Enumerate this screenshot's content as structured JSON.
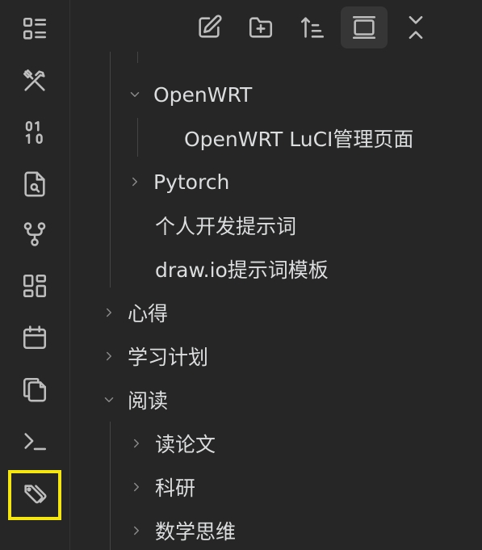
{
  "ribbon": {
    "items": [
      {
        "icon": "list-icon"
      },
      {
        "icon": "tools-icon"
      },
      {
        "icon": "binary-icon"
      },
      {
        "icon": "file-search-icon"
      },
      {
        "icon": "git-fork-icon"
      },
      {
        "icon": "layout-grid-icon"
      },
      {
        "icon": "calendar-icon"
      },
      {
        "icon": "copy-icon"
      },
      {
        "icon": "terminal-icon"
      },
      {
        "icon": "tags-icon",
        "highlighted": true
      }
    ],
    "highlight_color": "#f5e60f"
  },
  "toolbar": {
    "buttons": [
      {
        "icon": "new-note-icon"
      },
      {
        "icon": "new-folder-icon"
      },
      {
        "icon": "sort-icon"
      },
      {
        "icon": "collapse-all-icon",
        "active": true
      },
      {
        "icon": "close-icon"
      }
    ]
  },
  "tree": {
    "items": [
      {
        "label": "OpenWRT",
        "expanded": true
      },
      {
        "label": "OpenWRT LuCI管理页面"
      },
      {
        "label": "Pytorch",
        "expanded": false
      },
      {
        "label": "个人开发提示词"
      },
      {
        "label": "draw.io提示词模板"
      },
      {
        "label": "心得",
        "expanded": false
      },
      {
        "label": "学习计划",
        "expanded": false
      },
      {
        "label": "阅读",
        "expanded": true
      },
      {
        "label": "读论文",
        "expanded": false
      },
      {
        "label": "科研",
        "expanded": false
      },
      {
        "label": "数学思维",
        "expanded": false
      }
    ]
  }
}
